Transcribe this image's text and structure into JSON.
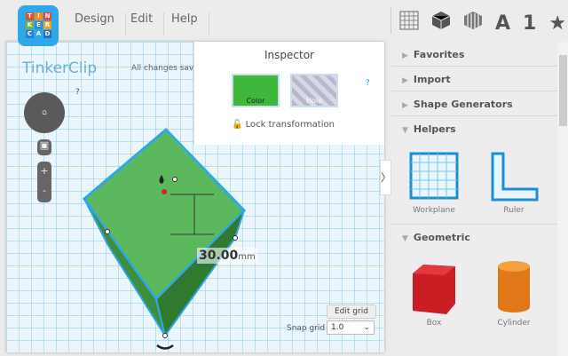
{
  "logo": {
    "letters": [
      "T",
      "I",
      "N",
      "K",
      "E",
      "R",
      "C",
      "A",
      "D"
    ]
  },
  "menu": [
    "Design",
    "Edit",
    "Help"
  ],
  "toolbar": {
    "icons": [
      "grid-icon",
      "cube-icon",
      "striped-cube-icon",
      "text-icon",
      "number-icon",
      "star-icon"
    ],
    "text_label": "A",
    "number_label": "1",
    "star_label": "★"
  },
  "canvas": {
    "title": "TinkerClip",
    "status": "All changes saved",
    "help": "?",
    "dimension_value": "30.00",
    "dimension_unit": "mm",
    "edit_grid": "Edit grid",
    "snap_grid_label": "Snap grid",
    "snap_grid_value": "1.0"
  },
  "inspector": {
    "title": "Inspector",
    "color_label": "Color",
    "hole_label": "Hole",
    "help": "?",
    "lock_label": "Lock transformation",
    "color": "#3db83d"
  },
  "sidebar": {
    "sections": [
      "Favorites",
      "Import",
      "Shape Generators",
      "Helpers",
      "Geometric"
    ],
    "helpers": [
      "Workplane",
      "Ruler"
    ],
    "geometric": [
      "Box",
      "Cylinder"
    ]
  }
}
